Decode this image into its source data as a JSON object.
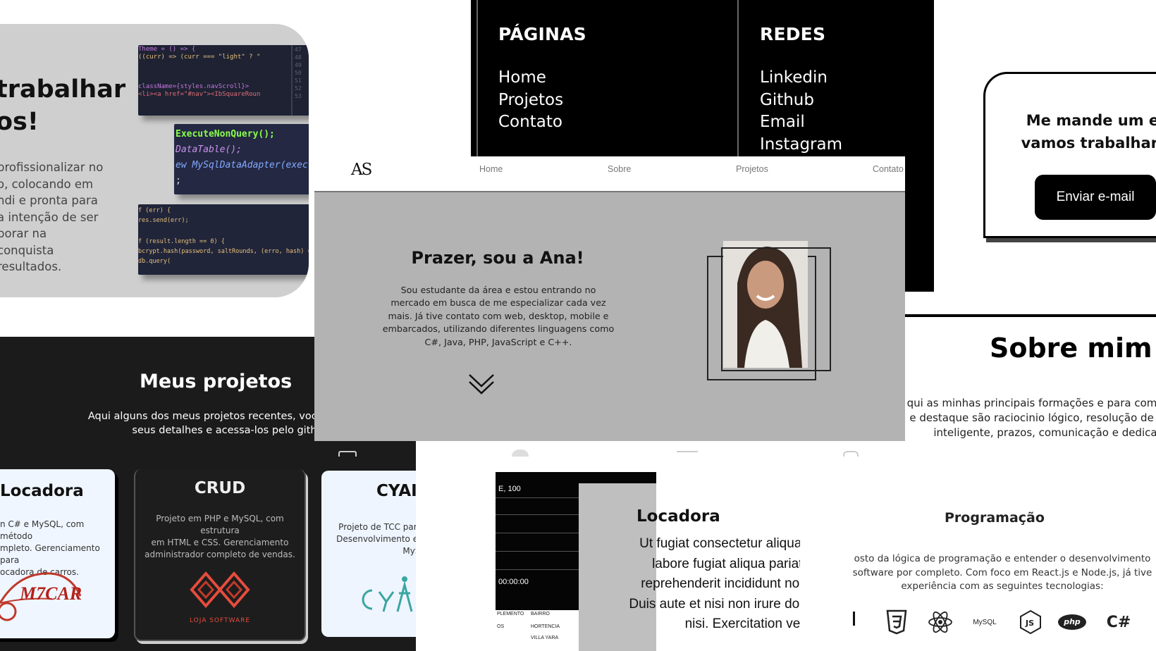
{
  "work_panel": {
    "title_line1": "trabalhar",
    "title_line2": "os!",
    "description_lines": [
      "profissionalizar no",
      "o, colocando em",
      "ndi e pronta para",
      "a intenção de ser",
      "borar na conquista",
      "resultados."
    ]
  },
  "code_snippets": {
    "snippet1": [
      "Theme = () => {",
      "((curr) => (curr === \"light\" ? \"",
      "",
      "className={styles.navScroll}>",
      "<li><a href=\"#nav\"><IbSquareRoun"
    ],
    "snippet1_side": [
      "pad",
      "bor",
      "bor",
      "ani",
      "ani",
      "tra"
    ],
    "snippet1_numbers": [
      "47",
      "48",
      "49",
      "50",
      "51",
      "52",
      "53"
    ],
    "snippet2": [
      "ExecuteNonQuery();",
      "DataTable();",
      "ew MySqlDataAdapter(exec",
      ";"
    ],
    "snippet3": [
      "f (err) {",
      "  res.send(err);",
      "",
      "f (result.length == 0) {",
      "  bcrypt.hash(password, saltRounds, (erro, hash) =>",
      "    db.query("
    ]
  },
  "footer_links": {
    "pages_heading": "PÁGINAS",
    "pages": [
      "Home",
      "Projetos",
      "Contato"
    ],
    "social_heading": "REDES",
    "social": [
      "Linkedin",
      "Github",
      "Email",
      "Instagram"
    ]
  },
  "email_card": {
    "line1": "Me mande um ema",
    "line2": "vamos trabalhar jun",
    "button": "Enviar e-mail"
  },
  "about": {
    "title": "Sobre mim",
    "lines": [
      "qui as minhas principais formações e para completa",
      "e destaque são raciocinio lógico, resolução de prob",
      "inteligente, prazos, comunicação e dedica"
    ]
  },
  "projects": {
    "title": "Meus projetos",
    "subtitle_line1": "Aqui alguns dos meus projetos recentes, você pode conf",
    "subtitle_line2": "seus detalhes e acessa-los pelo github.",
    "cards": [
      {
        "title": "Locadora",
        "desc": [
          "n C# e MySQL, com método",
          "mpleto. Gerenciamento para",
          "ocadora de carros."
        ],
        "logo_text": "M7CAR"
      },
      {
        "title": "CRUD",
        "desc": [
          "Projeto em PHP e MySQL, com estrutura",
          "em HTML e CSS. Gerenciamento",
          "administrador completo de vendas."
        ],
        "logo_text": "LOJA SOFTWARE"
      },
      {
        "title": "CYAI",
        "desc": [
          "Projeto de TCC para in",
          "Desenvolvimento em R",
          "MySQL"
        ]
      }
    ]
  },
  "hero": {
    "logo": "AS",
    "nav": [
      "Home",
      "Sobre",
      "Projetos",
      "Contato"
    ],
    "title": "Prazer, sou a Ana!",
    "text_lines": [
      "Sou estudante da área e estou entrando no",
      "mercado em busca de me especializar cada vez",
      "mais. Já tive contato com web, desktop, mobile e",
      "embarcados, utilizando diferentes linguagens como",
      "C#, Java, PHP, JavaScript e C++."
    ]
  },
  "locadora_detail": {
    "screen_values": [
      "E, 100",
      "00:00:00"
    ],
    "table_headers": [
      "PLEMENTO",
      "BAIRRO"
    ],
    "table_rows": [
      [
        "OS",
        "HORTENCIA"
      ],
      [
        "",
        "VILLA YARA"
      ]
    ],
    "title": "Locadora",
    "text_lines": [
      "Ut fugiat consectetur aliqua r",
      "labore fugiat aliqua pariatu",
      "reprehenderit incididunt nost",
      "Duis aute et nisi non irure dolo",
      "nisi. Exercitation velit"
    ]
  },
  "programming": {
    "title": "Programação",
    "text_lines": [
      "osto da lógica de programação e entender o desenvolvimento",
      "software por completo. Com foco em React.js e Node.js, já tive",
      "experiência com as seguintes tecnologias:"
    ],
    "techs": [
      "css3-icon",
      "react-icon",
      "mysql-icon",
      "nodejs-icon",
      "php-icon",
      "csharp-icon"
    ],
    "mysql_label": "MySQL",
    "php_label": "php",
    "csharp_label": "C#"
  },
  "colors": {
    "dark_bg": "#1b1b1b",
    "hero_bg": "#b3b3b3",
    "grey_card": "#cfcfcf",
    "accent_red": "#c0392b"
  }
}
